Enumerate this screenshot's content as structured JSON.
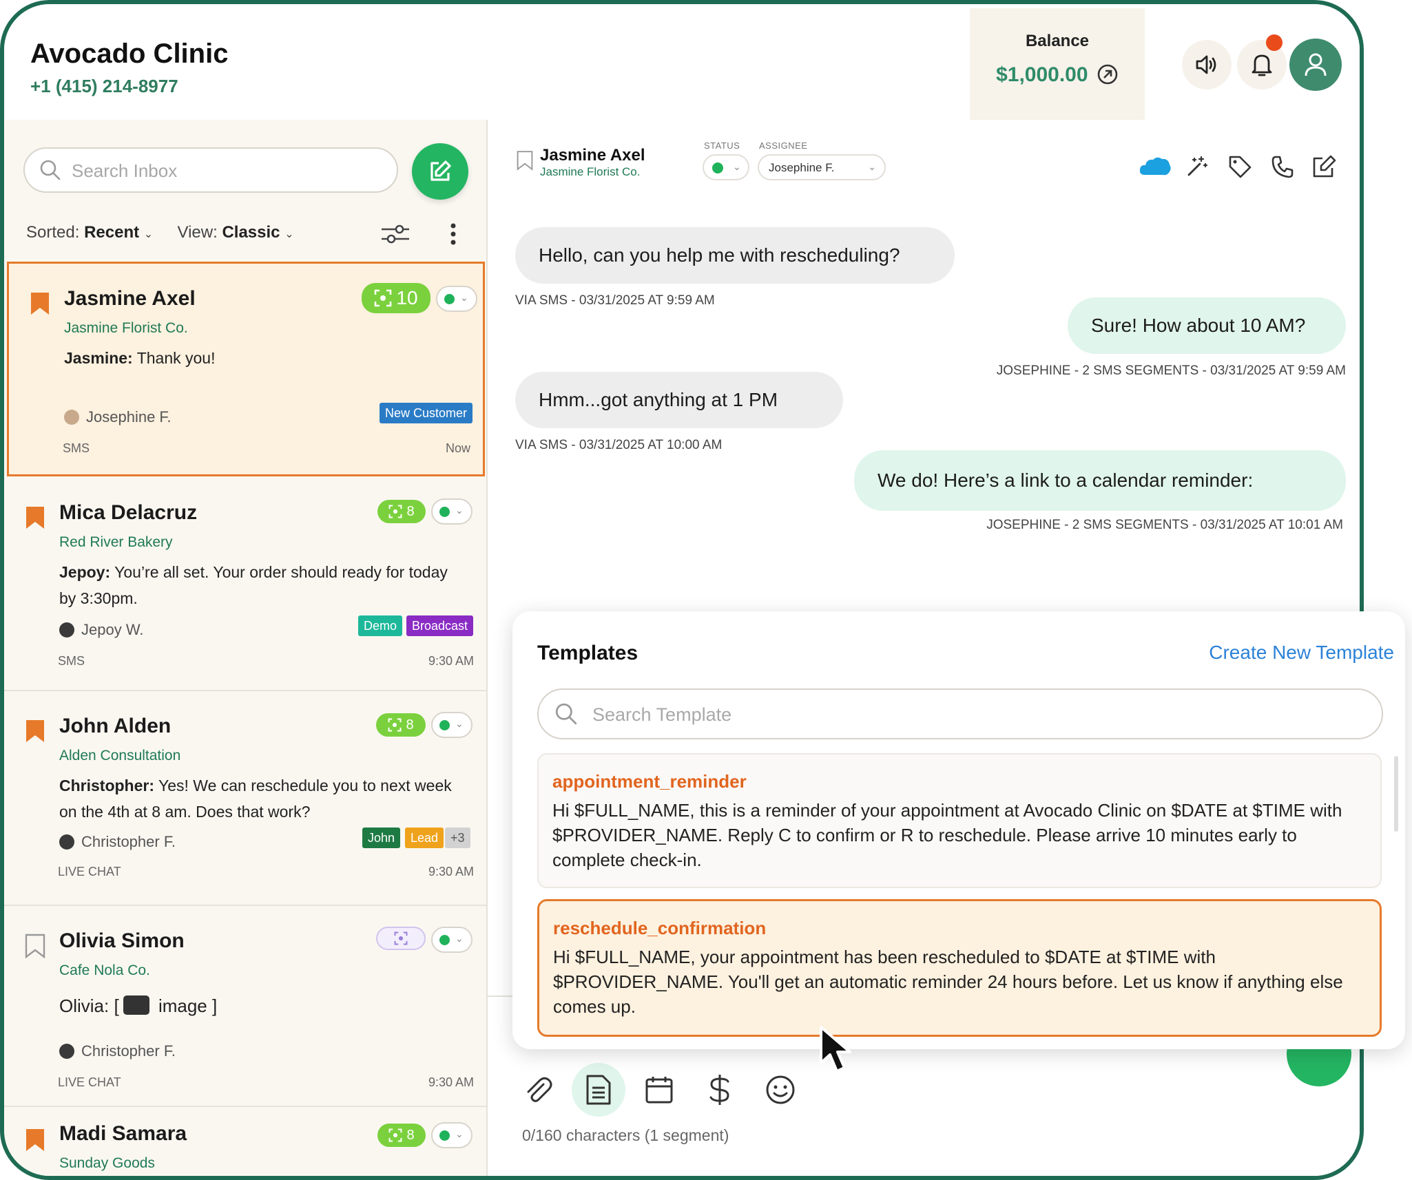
{
  "header": {
    "clinic_name": "Avocado Clinic",
    "clinic_phone": "+1 (415) 214-8977",
    "balance_label": "Balance",
    "balance_value": "$1,000.00",
    "icons": [
      "volume-icon",
      "bell-icon",
      "user-icon"
    ]
  },
  "sidebar": {
    "search_placeholder": "Search Inbox",
    "sort_label": "Sorted:",
    "sort_value": "Recent",
    "view_label": "View:",
    "view_value": "Classic",
    "conversations": [
      {
        "name": "Jasmine Axel",
        "company": "Jasmine Florist Co.",
        "preview_sender": "Jasmine:",
        "preview_text": "Thank you!",
        "agent": "Josephine F.",
        "channel": "SMS",
        "time": "Now",
        "score": "10",
        "tags": [
          {
            "label": "New Customer",
            "color": "#2a7bc6"
          }
        ]
      },
      {
        "name": "Mica Delacruz",
        "company": "Red River Bakery",
        "preview_sender": "Jepoy:",
        "preview_text": "You’re all set. Your order should ready for today by 3:30pm.",
        "agent": "Jepoy W.",
        "channel": "SMS",
        "time": "9:30 AM",
        "score": "8",
        "tags": [
          {
            "label": "Demo",
            "color": "#1db89a"
          },
          {
            "label": "Broadcast",
            "color": "#8a2bc4"
          }
        ]
      },
      {
        "name": "John Alden",
        "company": "Alden Consultation",
        "preview_sender": "Christopher:",
        "preview_text": "Yes! We can reschedule you to next week on the 4th at 8 am. Does that work?",
        "agent": "Christopher F.",
        "channel": "LIVE CHAT",
        "time": "9:30 AM",
        "score": "8",
        "tags": [
          {
            "label": "John",
            "color": "#1e7a43"
          },
          {
            "label": "Lead",
            "color": "#efa21b"
          },
          {
            "label": "+3",
            "color": "#d2d2d2"
          }
        ]
      },
      {
        "name": "Olivia Simon",
        "company": "Cafe Nola Co.",
        "preview_sender": "Olivia:",
        "preview_text": "image ]",
        "preview_prefix": "[",
        "agent": "Christopher F.",
        "channel": "LIVE CHAT",
        "time": "9:30 AM",
        "score": "",
        "tags": []
      },
      {
        "name": "Madi Samara",
        "company": "Sunday Goods",
        "score": "8"
      }
    ]
  },
  "chat": {
    "contact_name": "Jasmine Axel",
    "contact_company": "Jasmine Florist Co.",
    "status_label": "STATUS",
    "assignee_label": "ASSIGNEE",
    "assignee_value": "Josephine F.",
    "messages": [
      {
        "dir": "in",
        "text": "Hello, can you help me with rescheduling?",
        "meta": "VIA SMS - 03/31/2025 AT 9:59 AM"
      },
      {
        "dir": "out",
        "text": "Sure! How about 10 AM?",
        "meta": "JOSEPHINE - 2 SMS SEGMENTS - 03/31/2025 AT 9:59 AM"
      },
      {
        "dir": "in",
        "text": "Hmm...got anything at 1 PM",
        "meta": "VIA SMS - 03/31/2025 AT 10:00 AM"
      },
      {
        "dir": "out",
        "text": "We do! Here’s a link to a calendar reminder:",
        "meta": "JOSEPHINE - 2 SMS SEGMENTS - 03/31/2025 AT 10:01 AM"
      }
    ],
    "char_count": "0/160 characters  (1 segment)"
  },
  "templates": {
    "title": "Templates",
    "create_label": "Create New Template",
    "search_placeholder": "Search Template",
    "items": [
      {
        "name": "appointment_reminder",
        "body": "Hi $FULL_NAME, this is a reminder of your appointment at Avocado Clinic on $DATE at $TIME with $PROVIDER_NAME. Reply C to confirm or R to reschedule. Please arrive 10 minutes early to complete check-in."
      },
      {
        "name": "reschedule_confirmation",
        "body": "Hi $FULL_NAME, your appointment has been rescheduled to $DATE at $TIME with $PROVIDER_NAME. You'll get an automatic reminder 24 hours before. Let us know if anything else comes up."
      }
    ]
  },
  "colors": {
    "brand_green": "#1e6b53",
    "accent_green": "#24b562",
    "selected_orange": "#e67a2a",
    "link_blue": "#2c82d8"
  }
}
